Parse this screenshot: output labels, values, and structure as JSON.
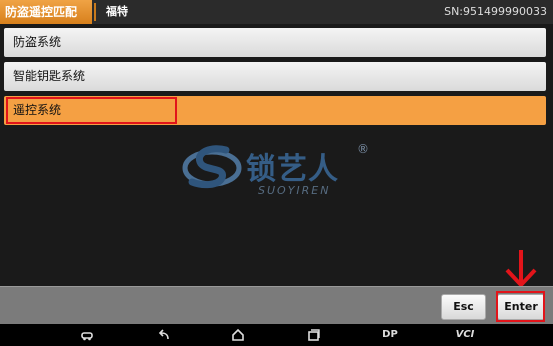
{
  "header": {
    "active_tab": "防盗遥控匹配",
    "breadcrumb": "福特",
    "serial": "SN:951499990033"
  },
  "menu": {
    "items": [
      {
        "label": "防盗系统"
      },
      {
        "label": "智能钥匙系统"
      },
      {
        "label": "遥控系统",
        "selected": true
      }
    ]
  },
  "logo": {
    "brand": "锁艺人",
    "registered": "®",
    "subtitle": "SUOYIREN"
  },
  "footer": {
    "esc_label": "Esc",
    "enter_label": "Enter"
  },
  "navbar": {
    "dp_label": "DP",
    "vci_label": "VCI"
  },
  "colors": {
    "accent": "#f5a043",
    "highlight": "#e2141a",
    "logo_blue": "#355d86"
  }
}
